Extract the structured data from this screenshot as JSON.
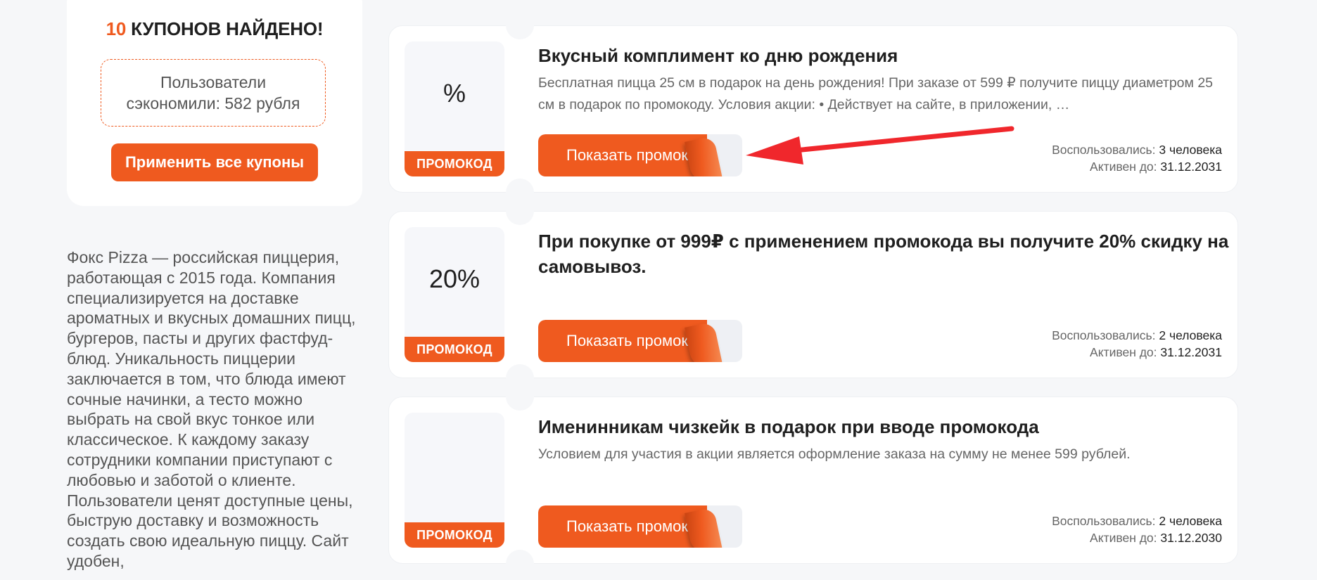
{
  "summary": {
    "count": "10",
    "title_rest": " КУПОНОВ НАЙДЕНО!",
    "saved_text": "Пользователи сэкономили: 582 рубля",
    "apply_all_label": "Применить все купоны"
  },
  "about": {
    "text": "Фокс Pizza — российская пиццерия, работающая с 2015 года. Компания специализируется на доставке ароматных и вкусных домашних пицц, бургеров, пасты и других фастфуд-блюд. Уникальность пиццерии заключается в том, что блюда имеют сочные начинки, а тесто можно выбрать на свой вкус тонкое или классическое. К каждому заказу сотрудники компании приступают с любовью и заботой о клиенте. Пользователи ценят доступные цены, быструю доставку и возможность создать свою идеальную пиццу. Сайт удобен,"
  },
  "coupons": [
    {
      "badge_value": "%",
      "badge_label": "ПРОМОКОД",
      "title": "Вкусный комплимент ко дню рождения",
      "description": "Бесплатная пицца 25 см в подарок на день рождения! При заказе от 599 ₽ получите пиццу диаметром 25 см в подарок по промокоду. Условия акции: • Действует на сайте, в приложении, …",
      "button_label": "Показать промокод",
      "used_label": "Воспользовались:",
      "used_value": "3 человека",
      "active_label": "Активен до:",
      "active_value": "31.12.2031"
    },
    {
      "badge_value": "20%",
      "badge_label": "ПРОМОКОД",
      "title": "При покупке от 999₽ с применением промокода вы получите 20% скидку на самовывоз.",
      "description": "",
      "button_label": "Показать промокод",
      "used_label": "Воспользовались:",
      "used_value": "2 человека",
      "active_label": "Активен до:",
      "active_value": "31.12.2031"
    },
    {
      "badge_value": "",
      "badge_label": "ПРОМОКОД",
      "title": "Именинникам чизкейк в подарок при вводе промокода",
      "description": "Условием для участия в акции является оформление заказа на сумму не менее 599 рублей.",
      "button_label": "Показать промокод",
      "used_label": "Воспользовались:",
      "used_value": "2 человека",
      "active_label": "Активен до:",
      "active_value": "31.12.2030"
    }
  ],
  "colors": {
    "accent": "#ef5a1f",
    "annotation_arrow": "#f0272c",
    "background": "#f6f7f9"
  }
}
